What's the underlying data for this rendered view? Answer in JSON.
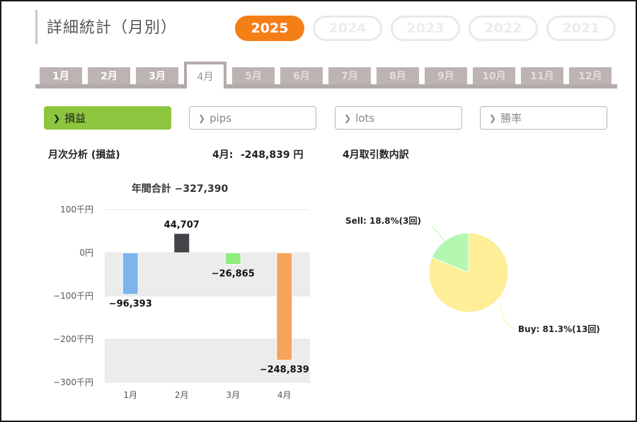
{
  "header": {
    "title": "詳細統計（月別）"
  },
  "years": [
    "2025",
    "2024",
    "2023",
    "2022",
    "2021"
  ],
  "months": [
    "1月",
    "2月",
    "3月",
    "4月",
    "5月",
    "6月",
    "7月",
    "8月",
    "9月",
    "10月",
    "11月",
    "12月"
  ],
  "metrics": [
    "損益",
    "pips",
    "lots",
    "勝率"
  ],
  "summary": {
    "section_title": "月次分析 (損益)",
    "month_label": "4月:",
    "month_value": "-248,839 円",
    "breakdown_title": "4月取引数内訳"
  },
  "chart_data": [
    {
      "type": "bar",
      "title": "年間合計 −327,390",
      "categories": [
        "1月",
        "2月",
        "3月",
        "4月"
      ],
      "values": [
        -96393,
        44707,
        -26865,
        -248839
      ],
      "value_labels": [
        "−96,393",
        "44,707",
        "−26,865",
        "−248,839"
      ],
      "colors": [
        "#7cb5ec",
        "#434348",
        "#90ed7d",
        "#f7a35c"
      ],
      "ylim": [
        -300000,
        100000
      ],
      "yticks": [
        100000,
        0,
        -100000,
        -200000,
        -300000
      ],
      "ytick_labels": [
        "100千円",
        "0円",
        "−100千円",
        "−200千円",
        "−300千円"
      ],
      "grid": "alternating bands"
    },
    {
      "type": "pie",
      "slices": [
        {
          "label": "Sell: 18.8%(3回)",
          "percent": 18.8,
          "color": "#b3f7b0"
        },
        {
          "label": "Buy: 81.3%(13回)",
          "percent": 81.3,
          "color": "#fdee97"
        }
      ]
    }
  ]
}
